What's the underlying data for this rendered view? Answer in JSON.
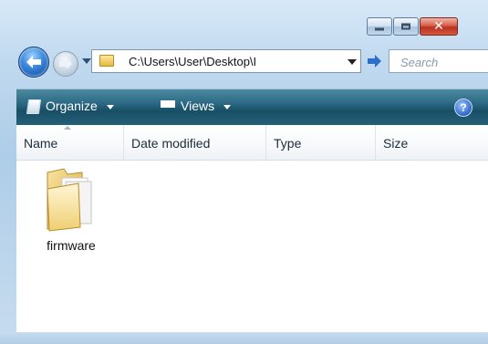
{
  "window": {
    "caption_buttons": {
      "minimize_icon": "minimize-icon",
      "maximize_icon": "maximize-icon",
      "close_glyph": "✕"
    }
  },
  "nav": {
    "back_icon": "back-arrow-icon",
    "forward_icon": "forward-arrow-icon",
    "address": "C:\\Users\\User\\Desktop\\I",
    "search_placeholder": "Search"
  },
  "command_bar": {
    "organize_label": "Organize",
    "views_label": "Views",
    "help_glyph": "?"
  },
  "columns": [
    {
      "label": "Name"
    },
    {
      "label": "Date modified"
    },
    {
      "label": "Type"
    },
    {
      "label": "Size"
    }
  ],
  "files": [
    {
      "name": "firmware",
      "icon": "folder-icon"
    }
  ],
  "colors": {
    "command_bar": "#245f77",
    "close_button": "#c9432e",
    "frame": "#b8d3ea"
  }
}
